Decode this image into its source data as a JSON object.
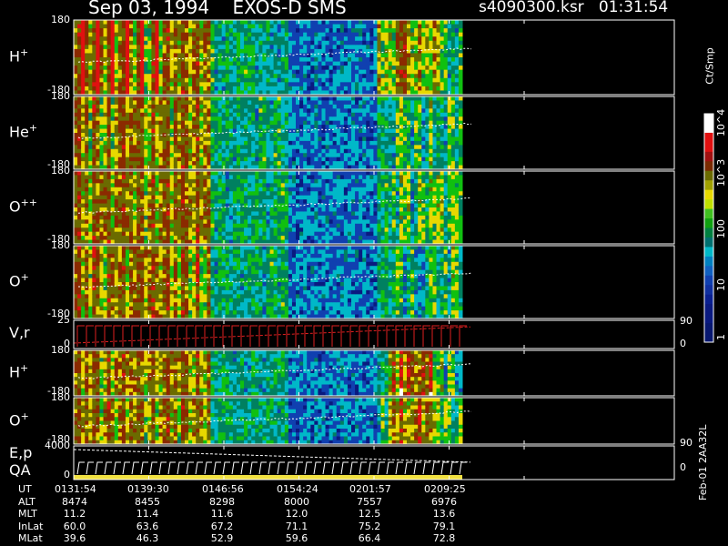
{
  "header": {
    "title": "Sep 03, 1994    EXOS-D SMS",
    "file": "s4090300.ksr   01:31:54"
  },
  "colorbar": {
    "unit": "Ct/Smp",
    "ticks": [
      "10^4",
      "10^3",
      "100",
      "10",
      "1"
    ],
    "colors": [
      "#ffffff",
      "#e01010",
      "#8b2a00",
      "#6b6b00",
      "#e8d800",
      "#10c010",
      "#008060",
      "#00b8c8",
      "#1040b0",
      "#0a1a80"
    ]
  },
  "chart_data": {
    "type": "heatmap",
    "panels": [
      {
        "label": "H",
        "sup": "+",
        "ymin": "-180",
        "ymax": "180"
      },
      {
        "label": "He",
        "sup": "+",
        "ymin": "-180",
        "ymax": "180"
      },
      {
        "label": "O",
        "sup": "++",
        "ymin": "-180",
        "ymax": "180"
      },
      {
        "label": "O",
        "sup": "+",
        "ymin": "-180",
        "ymax": "180"
      },
      {
        "label": "V,r",
        "sup": "",
        "ymin": "0",
        "ymax": "25",
        "right_top": "90",
        "right_bottom": "0"
      },
      {
        "label": "H",
        "sup": "+",
        "ymin": "-180",
        "ymax": "180"
      },
      {
        "label": "O",
        "sup": "+",
        "ymin": "-180",
        "ymax": "180"
      },
      {
        "label": "E,p",
        "sup": "",
        "label2": "QA",
        "ymin": "0",
        "ymax": "4000",
        "right_top": "90",
        "right_bottom": "0"
      }
    ],
    "time_axis": {
      "UT": [
        "0131:54",
        "0139:30",
        "0146:56",
        "0154:24",
        "0201:57",
        "0209:25"
      ],
      "ALT": [
        "8474",
        "8455",
        "8298",
        "8000",
        "7557",
        "6976"
      ],
      "MLT": [
        "11.2",
        "11.4",
        "11.6",
        "12.0",
        "12.5",
        "13.6"
      ],
      "InvLat": [
        "60.0",
        "63.6",
        "67.2",
        "71.1",
        "75.2",
        "79.1"
      ],
      "MLat": [
        "39.6",
        "46.3",
        "52.9",
        "59.6",
        "66.4",
        "72.8"
      ]
    },
    "row_labels": [
      "UT",
      "ALT",
      "MLT",
      "InLat",
      "MLat"
    ]
  },
  "footer": {
    "id": "Feb-01 2AA32L"
  }
}
